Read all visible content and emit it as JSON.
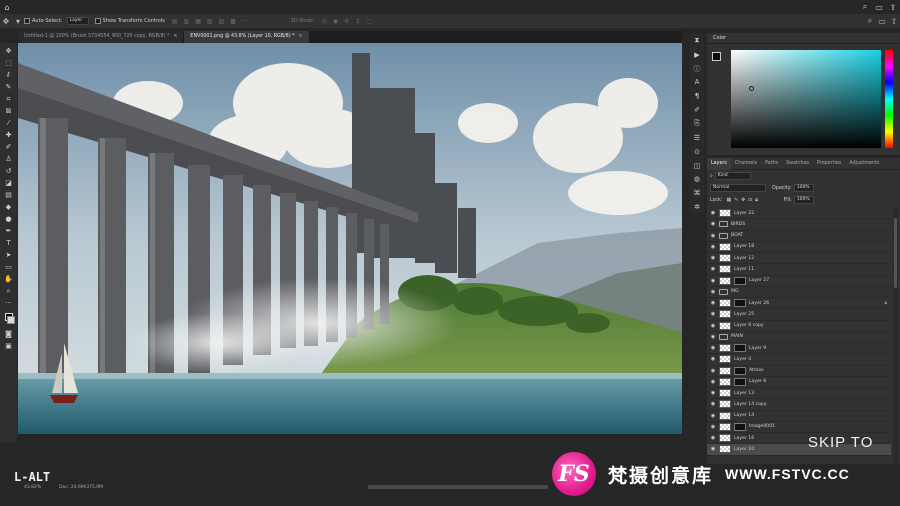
{
  "appbar": {
    "icons": [
      "home-icon",
      "search-icon",
      "workspace-icon",
      "share-icon",
      "minimize-icon",
      "maximize-icon",
      "close-icon"
    ]
  },
  "options": {
    "auto_select_label": "Auto-Select:",
    "auto_select_value": "Layer",
    "transform_label": "Show Transform Controls",
    "mode_3d_label": "3D Mode:"
  },
  "tabs": [
    {
      "label": "Untitled-1 @ 100% (Brush 5734554_900_720 copy, RGB/8) *",
      "close": "×"
    },
    {
      "label": "ENV0001.png @ 43.8% (Layer 10, RGB/8) *",
      "close": "×"
    }
  ],
  "status": {
    "zoom": "43.82%",
    "doc": "Doc: 24.6M/375.9M"
  },
  "color_panel": {
    "title": "Color",
    "accent": "#1ad0e3"
  },
  "layers_panel": {
    "tabs": [
      "Layers",
      "Channels",
      "Paths",
      "Swatches",
      "Properties",
      "Adjustments"
    ],
    "filter_label": "Kind",
    "blend_mode": "Normal",
    "opacity_label": "Opacity:",
    "opacity_value": "100%",
    "lock_label": "Lock:",
    "fill_label": "Fill:",
    "fill_value": "100%",
    "layers": [
      {
        "name": "Layer 22",
        "kind": "layer"
      },
      {
        "name": "BIRDS",
        "kind": "group"
      },
      {
        "name": "BOAT",
        "kind": "group"
      },
      {
        "name": "Layer 18",
        "kind": "layer"
      },
      {
        "name": "Layer 12",
        "kind": "layer"
      },
      {
        "name": "Layer 11",
        "kind": "layer"
      },
      {
        "name": "Layer 27",
        "kind": "masked"
      },
      {
        "name": "MG",
        "kind": "group"
      },
      {
        "name": "Layer 26",
        "kind": "masked",
        "locked": true
      },
      {
        "name": "Layer 25",
        "kind": "layer"
      },
      {
        "name": "Layer 8 copy",
        "kind": "layer"
      },
      {
        "name": "MAIN",
        "kind": "group"
      },
      {
        "name": "Layer 9",
        "kind": "masked"
      },
      {
        "name": "Layer 4",
        "kind": "layer"
      },
      {
        "name": "Atmos",
        "kind": "masked"
      },
      {
        "name": "Layer 8",
        "kind": "masked"
      },
      {
        "name": "Layer 13",
        "kind": "layer"
      },
      {
        "name": "Layer 14 copy",
        "kind": "layer"
      },
      {
        "name": "Layer 14",
        "kind": "layer"
      },
      {
        "name": "Image0001",
        "kind": "masked"
      },
      {
        "name": "Layer 16",
        "kind": "layer"
      },
      {
        "name": "Layer 10",
        "kind": "layer",
        "active": true
      }
    ]
  },
  "overlays": {
    "skip": "SKIP TO",
    "shortcut": "L-ALT",
    "watermark_logo": "FS",
    "watermark_text": "梵摄创意库",
    "watermark_url": "WWW.FSTVC.CC"
  }
}
